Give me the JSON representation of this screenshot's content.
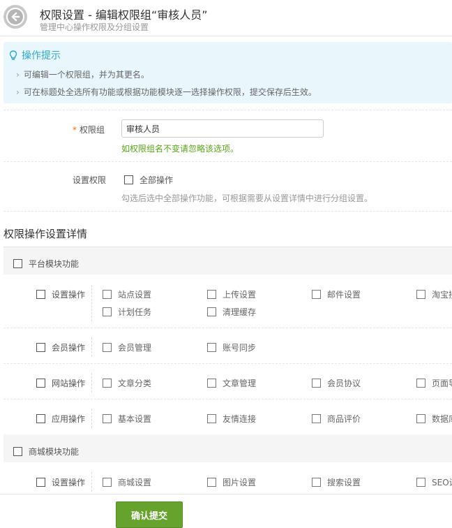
{
  "header": {
    "title": "权限设置 - 编辑权限组“审核人员”",
    "subtitle": "管理中心操作权限及分组设置"
  },
  "tips": {
    "title": "操作提示",
    "lines": [
      "可编辑一个权限组，并为其更名。",
      "可在标题处全选所有功能或根据功能模块逐一选择操作权限，提交保存后生效。"
    ]
  },
  "form": {
    "group_label": "权限组",
    "group_value": "审核人员",
    "group_hint": "如权限组名不变请忽略该选项。",
    "perm_label": "设置权限",
    "all_label": "全部操作",
    "perm_hint": "勾选后选中全部操作功能，可根据需要从设置详情中进行分组设置。"
  },
  "detail": {
    "title": "权限操作设置详情",
    "platform_group": "平台模块功能",
    "shop_group": "商城模块功能",
    "rows": [
      {
        "label": "设置操作",
        "items": [
          "站点设置",
          "上传设置",
          "邮件设置",
          "淘宝接",
          "计划任务",
          "清理缓存"
        ]
      },
      {
        "label": "会员操作",
        "items": [
          "会员管理",
          "账号同步"
        ]
      },
      {
        "label": "网站操作",
        "items": [
          "文章分类",
          "文章管理",
          "会员协议",
          "页面导"
        ]
      },
      {
        "label": "应用操作",
        "items": [
          "基本设置",
          "友情连接",
          "商品评价",
          "数据库"
        ]
      },
      {
        "label": "设置操作",
        "items": [
          "商城设置",
          "图片设置",
          "搜索设置",
          "SEO设"
        ]
      }
    ]
  },
  "submit_label": "确认提交"
}
